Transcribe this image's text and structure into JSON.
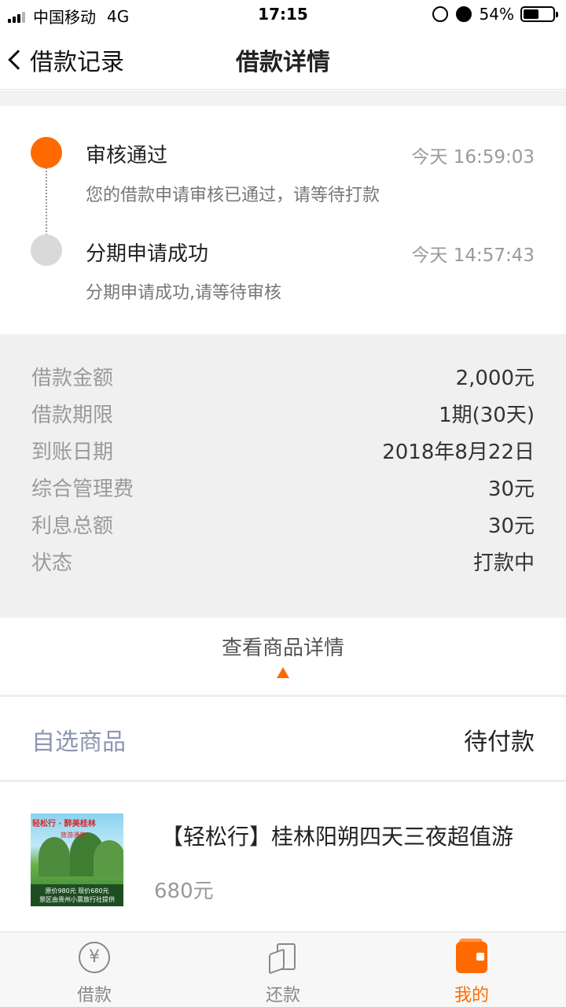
{
  "status_bar": {
    "carrier": "中国移动",
    "network": "4G",
    "time": "17:15",
    "battery": "54%",
    "battery_level": 0.54
  },
  "navbar": {
    "back_label": "借款记录",
    "title": "借款详情"
  },
  "timeline": [
    {
      "title": "审核通过",
      "time": "今天 16:59:03",
      "desc": "您的借款申请审核已通过，请等待打款",
      "active": true,
      "dot_color": "#ff6a00"
    },
    {
      "title": "分期申请成功",
      "time": "今天 14:57:43",
      "desc": "分期申请成功,请等待审核",
      "active": false,
      "dot_color": "#d9d9d9"
    }
  ],
  "details": [
    {
      "label": "借款金额",
      "value": "2,000元"
    },
    {
      "label": "借款期限",
      "value": "1期(30天)"
    },
    {
      "label": "到账日期",
      "value": "2018年8月22日"
    },
    {
      "label": "综合管理费",
      "value": "30元"
    },
    {
      "label": "利息总额",
      "value": "30元"
    },
    {
      "label": "状态",
      "value": "打款中"
    }
  ],
  "view_product": {
    "label": "查看商品详情"
  },
  "product_section": {
    "label": "自选商品",
    "status": "待付款"
  },
  "product": {
    "title": "【轻松行】桂林阳朔四天三夜超值游",
    "price": "680元",
    "thumb": {
      "headline": "轻松行 · 醉美桂林",
      "subline": "旅游通告",
      "price_line": "原价980元  现价680元",
      "footer": "景区由贵州小票旅行社提供"
    }
  },
  "tabbar": [
    {
      "label": "借款",
      "icon": "yuan-coin-icon",
      "active": false
    },
    {
      "label": "还款",
      "icon": "repay-cards-icon",
      "active": false
    },
    {
      "label": "我的",
      "icon": "wallet-icon",
      "active": true
    }
  ],
  "colors": {
    "accent": "#ff6a00",
    "muted_text": "#9a9a9a",
    "section_bg": "#f0f0f0"
  }
}
